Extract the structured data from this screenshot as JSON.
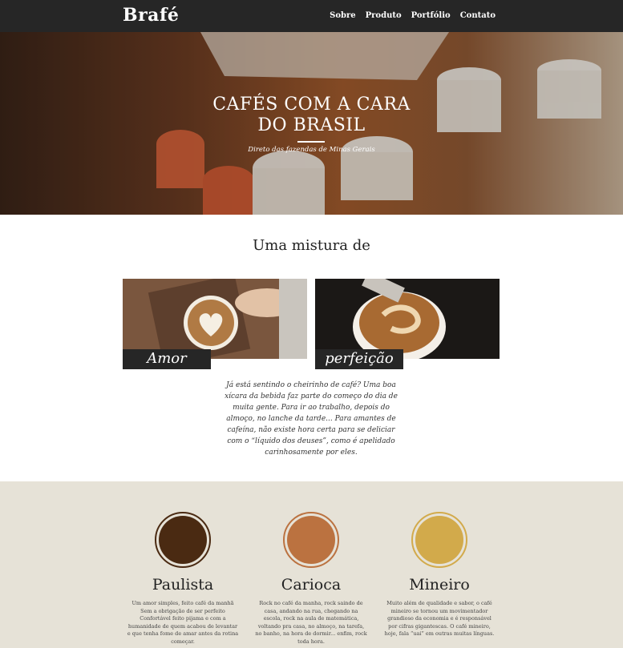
{
  "header": {
    "logo": "Brafé",
    "nav": [
      "Sobre",
      "Produto",
      "Portfólio",
      "Contato"
    ]
  },
  "hero": {
    "title_line1": "CAFÉS COM A CARA",
    "title_line2": "DO BRASIL",
    "subtitle": "Direto das fazendas de Minas Gerais"
  },
  "mix": {
    "heading": "Uma mistura de",
    "cards": [
      {
        "label": "Amor"
      },
      {
        "label": "perfeição"
      }
    ],
    "text": "Já está sentindo o cheirinho de café? Uma boa xícara da bebida faz parte do começo do dia de muita gente. Para ir ao trabalho, depois do almoço, no lanche da tarde... Para amantes de cafeína, não existe hora certa para se deliciar com o “líquido dos deuses”, como é apelidado carinhosamente por eles."
  },
  "varieties": [
    {
      "name": "Paulista",
      "color": "#4a2a12",
      "ring": "#4a2a12",
      "description": "Um amor simples, feito café da manhã Sem a obrigação de ser perfeito Confortável feito pijama e com a humanidade de quem acabou de levantar e que tenha fome de amar antes da rotina começar."
    },
    {
      "name": "Carioca",
      "color": "#bb7240",
      "ring": "#bb7240",
      "description": "Rock no café da manha, rock saindo de casa, andando na rua, chegando na escola, rock na aula de matemática, voltando pra casa, no almoço, na tarefa, no banho, na hora de dormir... enfim, rock toda hora."
    },
    {
      "name": "Mineiro",
      "color": "#d2aa4b",
      "ring": "#d2aa4b",
      "description": "Muito além de qualidade e sabor, o café mineiro se tornou um movimentador grandioso da economia e é responsável por cifras gigantescas. O café mineiro, hoje, fala “uai” em outras muitas línguas."
    }
  ]
}
